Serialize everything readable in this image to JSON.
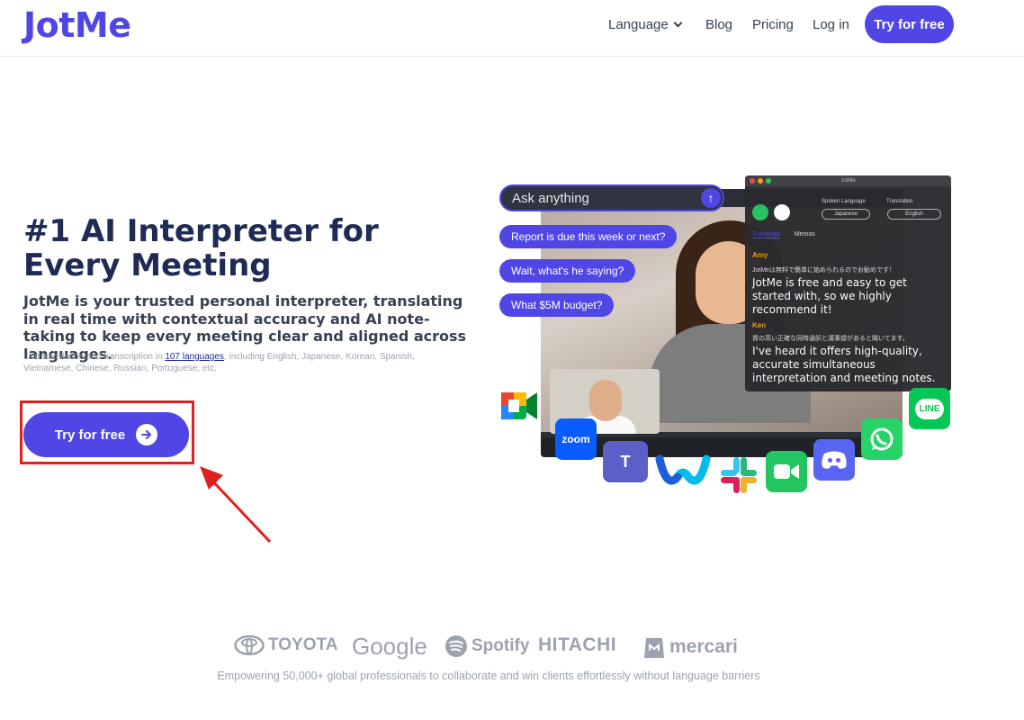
{
  "header": {
    "logo": "JotMe",
    "nav": {
      "language": "Language",
      "blog": "Blog",
      "pricing": "Pricing",
      "login": "Log in"
    },
    "cta": "Try for free"
  },
  "hero": {
    "title_line1": "#1 AI Interpreter for",
    "title_line2": "Every Meeting",
    "subtitle": "JotMe is your trusted personal interpreter, translating in real time with contextual accuracy and AI note-taking to keep every meeting clear and aligned across languages.",
    "small_prefix": "Live translation and transcription in ",
    "small_link": "107 languages",
    "small_suffix": ", including English, Japanese, Korean, Spanish, Vietnamese, Chinese, Russian, Portuguese, etc.",
    "cta": "Try for free"
  },
  "illustration": {
    "ask_placeholder": "Ask anything",
    "chips": [
      "Report is due this week or next?",
      "Wait, what's he saying?",
      "What $5M budget?"
    ],
    "panel": {
      "window_title": "JotMe",
      "spoken_language_label": "Spoken Language",
      "spoken_language_value": "Japanese",
      "translation_label": "Translation",
      "translation_value": "English",
      "tabs": [
        "Transcript",
        "Memos"
      ],
      "entries": [
        {
          "speaker": "Amy",
          "original": "JotMeは無料で簡単に始められるのでお勧めです！",
          "translation": "JotMe is free and easy to get started with, so we highly recommend it!"
        },
        {
          "speaker": "Ken",
          "original": "質の高い正確な同時通訳と議事録があると聞いてます。",
          "translation": "I've heard it offers high-quality, accurate simultaneous interpretation and meeting notes."
        }
      ]
    },
    "app_icons": {
      "zoom": "zoom",
      "line": "LINE",
      "teams": "T"
    }
  },
  "brands": {
    "items": [
      "TOYOTA",
      "Google",
      "Spotify",
      "HITACHI",
      "mercari"
    ],
    "caption": "Empowering 50,000+ global professionals to collaborate and win clients effortlessly without language barriers"
  },
  "colors": {
    "brand": "#4f46e5",
    "title": "#1f2a55",
    "annotation_red": "#e02020"
  }
}
